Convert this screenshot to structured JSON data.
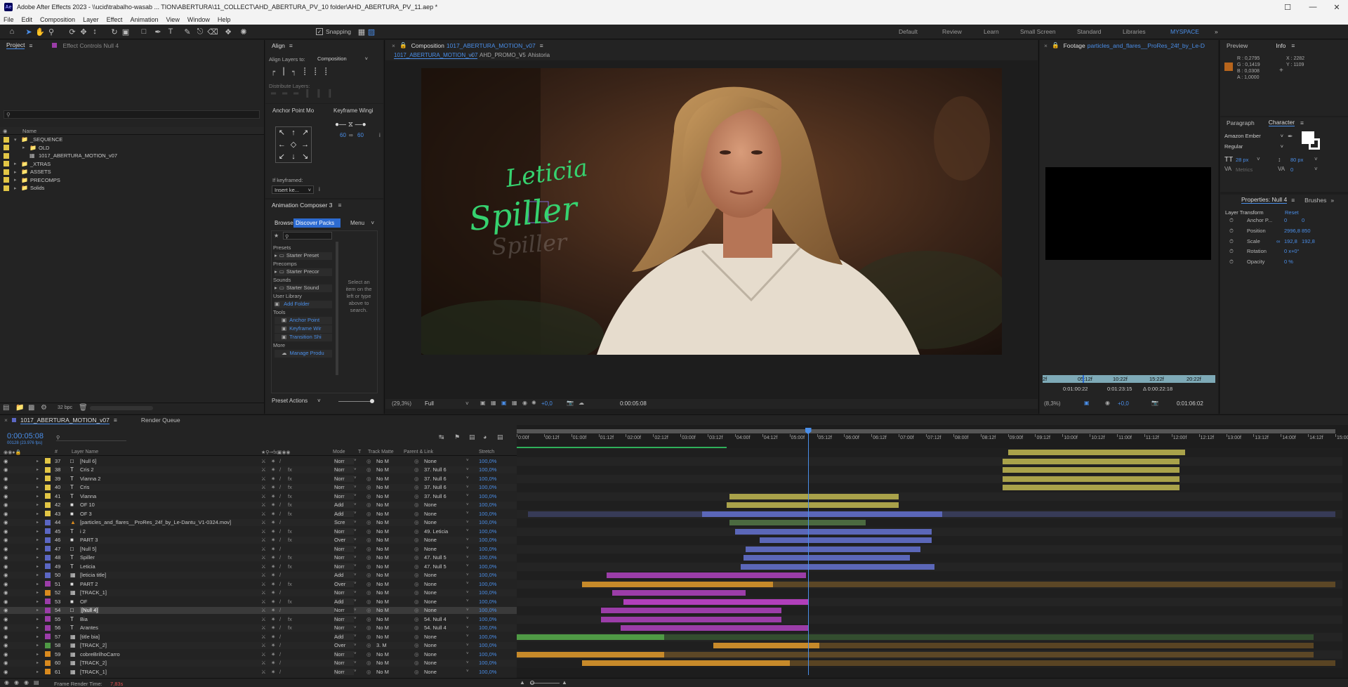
{
  "window": {
    "title": "Adobe After Effects 2023 - \\\\ucid\\trabalho-wasab ... TION\\ABERTURA\\11_COLLECT\\AHD_ABERTURA_PV_10 folder\\AHD_ABERTURA_PV_11.aep *",
    "logo": "Ae"
  },
  "menu": [
    "File",
    "Edit",
    "Composition",
    "Layer",
    "Effect",
    "Animation",
    "View",
    "Window",
    "Help"
  ],
  "toolbar": {
    "snapping": "Snapping",
    "workspaces": [
      "Default",
      "Review",
      "Learn",
      "Small Screen",
      "Standard",
      "Libraries",
      "MYSPACE"
    ]
  },
  "project": {
    "tab_project": "Project",
    "tab_effect_controls": "Effect Controls Null 4",
    "search_placeholder": "",
    "col_name": "Name",
    "items": [
      {
        "label": "_SEQUENCE",
        "color": "#e2c645",
        "indent": 0,
        "icon": "folder"
      },
      {
        "label": "OLD",
        "color": "#e2c645",
        "indent": 1,
        "icon": "folder"
      },
      {
        "label": "1017_ABERTURA_MOTION_v07",
        "color": "#e2c645",
        "indent": 1,
        "icon": "comp"
      },
      {
        "label": "_XTRAS",
        "color": "#e2c645",
        "indent": 0,
        "icon": "folder"
      },
      {
        "label": "ASSETS",
        "color": "#e2c645",
        "indent": 0,
        "icon": "folder"
      },
      {
        "label": "PRECOMPS",
        "color": "#e2c645",
        "indent": 0,
        "icon": "folder"
      },
      {
        "label": "Solids",
        "color": "#e2c645",
        "indent": 0,
        "icon": "folder"
      }
    ],
    "bpc": "32 bpc"
  },
  "align": {
    "title": "Align",
    "align_to_label": "Align Layers to:",
    "align_to_value": "Composition",
    "distribute": "Distribute Layers:"
  },
  "anchor_point": {
    "title": "Anchor Point Mo",
    "if_keyframed": "If keyframed:",
    "insert": "Insert ke...",
    "info": "i"
  },
  "keyframe_wing": {
    "title": "Keyframe Wingi",
    "v1": "60",
    "v2": "60"
  },
  "animation_composer": {
    "title": "Animation Composer 3",
    "tab_browse": "Browse",
    "tab_packs": "Discover Packs",
    "menu": "Menu",
    "sections": [
      {
        "header": "Presets",
        "item": "Starter Preset"
      },
      {
        "header": "Precomps",
        "item": "Starter Precor"
      },
      {
        "header": "Sounds",
        "item": "Starter Sound"
      },
      {
        "header": "User Library",
        "item": "Add Folder"
      }
    ],
    "tools_header": "Tools",
    "tools": [
      "Anchor Point",
      "Keyframe Wir",
      "Transition Shi"
    ],
    "more_header": "More",
    "more_item": "Manage Produ",
    "select_hint": "Select an item on the left or type above to search.",
    "preset_actions": "Preset Actions"
  },
  "composition": {
    "tab_prefix": "Composition",
    "tab_name": "1017_ABERTURA_MOTION_v07",
    "breadcrumbs": [
      "1017_ABERTURA_MOTION_v07",
      "AHD_PROMO_V5",
      "Ahistoria"
    ],
    "overlay_text_1": "Leticia",
    "overlay_text_2": "Spiller",
    "overlay_text_3": "Spiller",
    "zoom": "(29,3%)",
    "resolution": "Full",
    "exposure": "+0,0",
    "time": "0:00:05:08"
  },
  "footage": {
    "tab_prefix": "Footage",
    "tab_name": "particles_and_flares__ProRes_24f_by_Le-D",
    "ruler": [
      "2f",
      "05:12f",
      "10:22f",
      "15:22f",
      "20:22f"
    ],
    "in": "0:01:00:22",
    "out": "0:01:23:15",
    "dur": "Δ 0:00:22:18",
    "zoom": "(8,3%)",
    "exposure": "+0,0",
    "time": "0:01:06:02"
  },
  "info": {
    "tab_preview": "Preview",
    "tab_info": "Info",
    "r": "R : 0,2795",
    "g": "G : 0,1419",
    "b": "B : 0,0308",
    "a": "A : 1,0000",
    "x": "X : 2282",
    "y": "Y : 1109",
    "sample_color": "#b7651c"
  },
  "character": {
    "tab_paragraph": "Paragraph",
    "tab_character": "Character",
    "font": "Amazon Ember",
    "style": "Regular",
    "size": "28 px",
    "leading": "80 px",
    "metrics": "Metrics",
    "tracking": "0"
  },
  "properties": {
    "title": "Properties: Null 4",
    "tab_brushes": "Brushes",
    "transform": "Layer Transform",
    "reset": "Reset",
    "rows": [
      {
        "label": "Anchor P...",
        "v1": "0",
        "v2": "0"
      },
      {
        "label": "Position",
        "v1": "2996,8",
        "v2": "850"
      },
      {
        "label": "Scale",
        "v1": "192,8",
        "v2": "192,8"
      },
      {
        "label": "Rotation",
        "v1": "0 x+0°",
        "v2": ""
      },
      {
        "label": "Opacity",
        "v1": "0 %",
        "v2": ""
      }
    ]
  },
  "timeline": {
    "tab_comp": "1017_ABERTURA_MOTION_v07",
    "tab_render": "Render Queue",
    "timecode": "0:00:05:08",
    "frames": "00128 (23.976 fps)",
    "cols": {
      "layer_name": "Layer Name",
      "mode": "Mode",
      "t": "T",
      "track_matte": "Track Matte",
      "parent": "Parent & Link",
      "stretch": "Stretch"
    },
    "ruler": [
      "0:00f",
      "00:12f",
      "01:00f",
      "01:12f",
      "02:00f",
      "02:12f",
      "03:00f",
      "03:12f",
      "04:00f",
      "04:12f",
      "05:00f",
      "05:12f",
      "06:00f",
      "06:12f",
      "07:00f",
      "07:12f",
      "08:00f",
      "08:12f",
      "09:00f",
      "09:12f",
      "10:00f",
      "10:12f",
      "11:00f",
      "11:12f",
      "12:00f",
      "12:12f",
      "13:00f",
      "13:12f",
      "14:00f",
      "14:12f",
      "15:00f"
    ],
    "footer": "Frame Render Time:",
    "render_time": "7,83s",
    "layers": [
      {
        "num": "37",
        "type": "sq",
        "name": "[Null 6]",
        "color": "#e2c645",
        "mode": "Norr",
        "tm": "No M",
        "parent": "None",
        "stretch": "100,0%"
      },
      {
        "num": "38",
        "type": "T",
        "name": "Cris 2",
        "color": "#e2c645",
        "mode": "Norr",
        "tm": "No M",
        "parent": "37. Null 6",
        "stretch": "100,0%"
      },
      {
        "num": "39",
        "type": "T",
        "name": "Vianna 2",
        "color": "#e2c645",
        "mode": "Norr",
        "tm": "No M",
        "parent": "37. Null 6",
        "stretch": "100,0%"
      },
      {
        "num": "40",
        "type": "T",
        "name": "Cris",
        "color": "#e2c645",
        "mode": "Norr",
        "tm": "No M",
        "parent": "37. Null 6",
        "stretch": "100,0%"
      },
      {
        "num": "41",
        "type": "T",
        "name": "Vianna",
        "color": "#e2c645",
        "mode": "Norr",
        "tm": "No M",
        "parent": "37. Null 6",
        "stretch": "100,0%"
      },
      {
        "num": "42",
        "type": "blk",
        "name": "OF 10",
        "color": "#e2c645",
        "mode": "Add",
        "tm": "No M",
        "parent": "None",
        "stretch": "100,0%"
      },
      {
        "num": "43",
        "type": "blk",
        "name": "OF 3",
        "color": "#e2c645",
        "mode": "Add",
        "tm": "No M",
        "parent": "None",
        "stretch": "100,0%"
      },
      {
        "num": "44",
        "type": "cone",
        "name": "[particles_and_flares__ProRes_24f_by_Le-Dantu_V1-0324.mov]",
        "color": "#5b67c4",
        "mode": "Scre",
        "tm": "No M",
        "parent": "None",
        "stretch": "100,0%"
      },
      {
        "num": "45",
        "type": "T",
        "name": "i 2",
        "color": "#5b67c4",
        "mode": "Norr",
        "tm": "No M",
        "parent": "49. Leticia",
        "stretch": "100,0%"
      },
      {
        "num": "46",
        "type": "blk",
        "name": "PART 3",
        "color": "#5b67c4",
        "mode": "Over",
        "tm": "No M",
        "parent": "None",
        "stretch": "100,0%"
      },
      {
        "num": "47",
        "type": "sq",
        "name": "[Null 5]",
        "color": "#5b67c4",
        "mode": "Norr",
        "tm": "No M",
        "parent": "None",
        "stretch": "100,0%"
      },
      {
        "num": "48",
        "type": "T",
        "name": "Spiller",
        "color": "#5b67c4",
        "mode": "Norr",
        "tm": "No M",
        "parent": "47. Null 5",
        "stretch": "100,0%"
      },
      {
        "num": "49",
        "type": "T",
        "name": "Leticia",
        "color": "#5b67c4",
        "mode": "Norr",
        "tm": "No M",
        "parent": "47. Null 5",
        "stretch": "100,0%"
      },
      {
        "num": "50",
        "type": "comp",
        "name": "[leticia title]",
        "color": "#5b67c4",
        "mode": "Add",
        "tm": "No M",
        "parent": "None",
        "stretch": "100,0%"
      },
      {
        "num": "51",
        "type": "blk",
        "name": "PART 2",
        "color": "#9b3da8",
        "mode": "Over",
        "tm": "No M",
        "parent": "None",
        "stretch": "100,0%"
      },
      {
        "num": "52",
        "type": "comp",
        "name": "[TRACK_1]",
        "color": "#d98a1e",
        "mode": "Norr",
        "tm": "No M",
        "parent": "None",
        "stretch": "100,0%"
      },
      {
        "num": "53",
        "type": "blk",
        "name": "OF",
        "color": "#9b3da8",
        "mode": "Add",
        "tm": "No M",
        "parent": "None",
        "stretch": "100,0%"
      },
      {
        "num": "54",
        "type": "sq",
        "name": "[Null 4]",
        "color": "#9b3da8",
        "mode": "Norr",
        "tm": "No M",
        "parent": "None",
        "stretch": "100,0%",
        "selected": true
      },
      {
        "num": "55",
        "type": "T",
        "name": "Bia",
        "color": "#9b3da8",
        "mode": "Norr",
        "tm": "No M",
        "parent": "54. Null 4",
        "stretch": "100,0%"
      },
      {
        "num": "56",
        "type": "T",
        "name": "Arantes",
        "color": "#9b3da8",
        "mode": "Norr",
        "tm": "No M",
        "parent": "54. Null 4",
        "stretch": "100,0%"
      },
      {
        "num": "57",
        "type": "comp",
        "name": "[title bia]",
        "color": "#9b3da8",
        "mode": "Add",
        "tm": "No M",
        "parent": "None",
        "stretch": "100,0%"
      },
      {
        "num": "58",
        "type": "comp",
        "name": "[TRACK_2]",
        "color": "#4f9a45",
        "mode": "Over",
        "tm": "3. M",
        "parent": "None",
        "stretch": "100,0%"
      },
      {
        "num": "59",
        "type": "comp",
        "name": "cobreBrilhoCarro",
        "color": "#d98a1e",
        "mode": "Norr",
        "tm": "No M",
        "parent": "None",
        "stretch": "100,0%"
      },
      {
        "num": "60",
        "type": "comp",
        "name": "[TRACK_2]",
        "color": "#d98a1e",
        "mode": "Norr",
        "tm": "No M",
        "parent": "None",
        "stretch": "100,0%"
      },
      {
        "num": "61",
        "type": "comp",
        "name": "[TRACK_1]",
        "color": "#d98a1e",
        "mode": "Norr",
        "tm": "No M",
        "parent": "None",
        "stretch": "100,0%"
      }
    ],
    "bars": [
      {
        "s": 9.0,
        "e": 12.25,
        "c": "#a9a24a"
      },
      {
        "s": 8.9,
        "e": 12.15,
        "c": "#a9a24a"
      },
      {
        "s": 8.9,
        "e": 12.15,
        "c": "#a9a24a"
      },
      {
        "s": 8.9,
        "e": 12.15,
        "c": "#a9a24a"
      },
      {
        "s": 8.9,
        "e": 12.15,
        "c": "#a9a24a"
      },
      {
        "s": 3.9,
        "e": 7.0,
        "c": "#a9a24a"
      },
      {
        "s": 3.85,
        "e": 7.0,
        "c": "#a9a24a"
      },
      {
        "s": 3.4,
        "e": 7.8,
        "c": "#5b67b8",
        "dim": [
          0.2,
          15.0
        ]
      },
      {
        "s": 3.9,
        "e": 6.4,
        "c": "#4b6a40"
      },
      {
        "s": 4.0,
        "e": 7.6,
        "c": "#5b67b8"
      },
      {
        "s": 4.45,
        "e": 7.6,
        "c": "#5b67b8"
      },
      {
        "s": 4.2,
        "e": 7.4,
        "c": "#5b67b8"
      },
      {
        "s": 4.15,
        "e": 7.2,
        "c": "#5b67b8"
      },
      {
        "s": 4.1,
        "e": 7.65,
        "c": "#5b67b8"
      },
      {
        "s": 1.65,
        "e": 5.3,
        "c": "#9b3da8"
      },
      {
        "s": 1.2,
        "e": 4.7,
        "c": "#c78a2a",
        "dim": [
          4.7,
          15.0
        ]
      },
      {
        "s": 1.75,
        "e": 4.2,
        "c": "#9b3da8"
      },
      {
        "s": 1.95,
        "e": 5.35,
        "c": "#b13fbb"
      },
      {
        "s": 1.55,
        "e": 4.85,
        "c": "#9b3da8"
      },
      {
        "s": 1.55,
        "e": 4.85,
        "c": "#9b3da8"
      },
      {
        "s": 1.9,
        "e": 5.35,
        "c": "#9b3da8"
      },
      {
        "s": 0.0,
        "e": 2.7,
        "c": "#4f9a45",
        "dim": [
          2.7,
          14.6
        ]
      },
      {
        "s": 3.6,
        "e": 5.55,
        "c": "#c78a2a",
        "dim": [
          5.55,
          14.6
        ]
      },
      {
        "s": 0.0,
        "e": 2.7,
        "c": "#c78a2a",
        "dim": [
          2.7,
          14.6
        ]
      },
      {
        "s": 1.2,
        "e": 5.0,
        "c": "#c78a2a",
        "dim": [
          5.0,
          15.0
        ]
      }
    ],
    "current_time_seconds": 5.333,
    "work_area_end_seconds": 3.85
  }
}
